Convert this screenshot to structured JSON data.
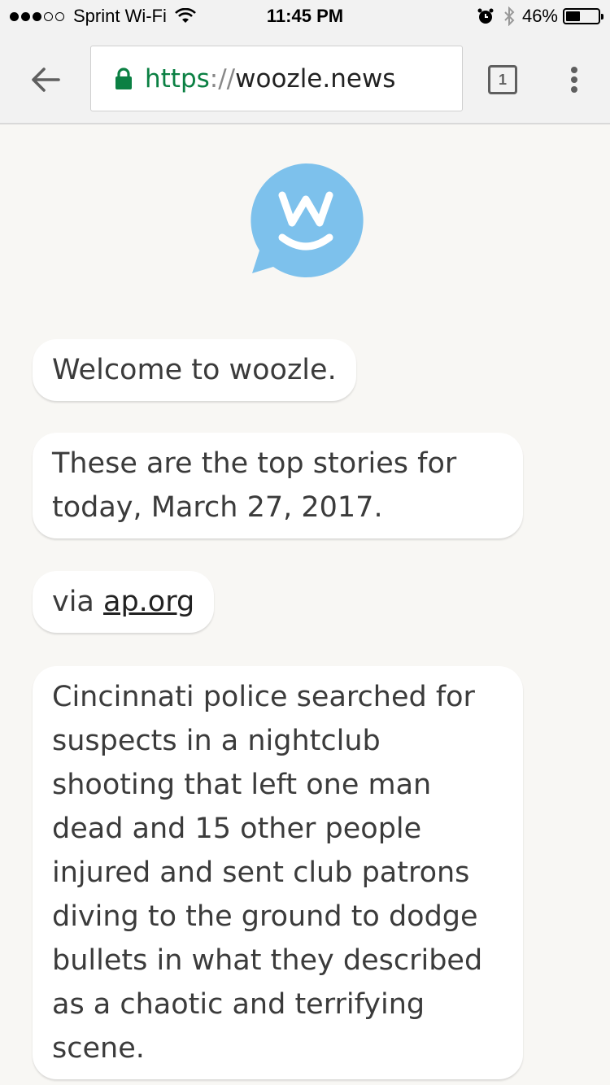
{
  "status_bar": {
    "carrier": "Sprint Wi-Fi",
    "time": "11:45 PM",
    "battery_percent_text": "46%",
    "battery_level": 0.46,
    "icons": [
      "signal-dots-icon",
      "wifi-icon",
      "alarm-icon",
      "bluetooth-icon",
      "battery-icon"
    ]
  },
  "browser": {
    "url_scheme": "https",
    "url_sep": "://",
    "url_host": "woozle.news",
    "tab_count": "1",
    "colors": {
      "lock": "#0b8043",
      "scheme": "#0b8043"
    }
  },
  "logo": {
    "icon": "woozle-logo-icon",
    "color": "#7dc1ec"
  },
  "messages": [
    {
      "text": "Welcome to woozle."
    },
    {
      "text": "These are the top stories for today, March 27, 2017."
    },
    {
      "prefix": "via ",
      "link": "ap.org"
    },
    {
      "text": "Cincinnati police searched for suspects in a nightclub shooting that left one man dead and 15 other people injured and sent club patrons diving to the ground to dodge bullets in what they described as a chaotic and terrifying scene."
    }
  ]
}
